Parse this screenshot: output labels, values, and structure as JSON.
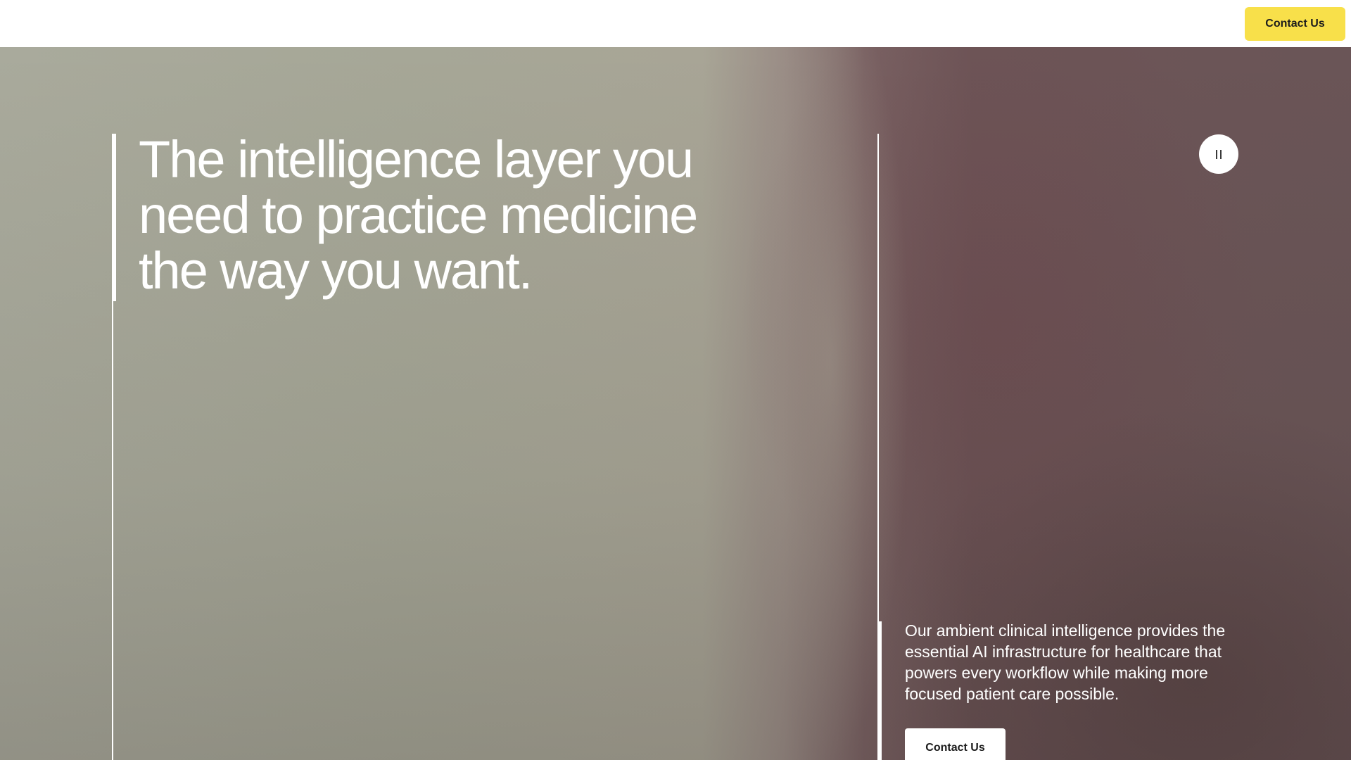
{
  "header": {
    "contact_button_label": "Contact Us"
  },
  "hero": {
    "headline": "The intelligence layer you need to practice medicine the way you want.",
    "description": "Our ambient clinical intelligence provides the essential AI infrastructure for healthcare that powers every workflow while making more focused patient care possible.",
    "contact_button_label": "Contact Us",
    "pause_icon": "pause-icon"
  },
  "colors": {
    "accent_yellow": "#f8e04a",
    "text_on_hero": "#ffffff",
    "button_text": "#1c1c1c"
  }
}
